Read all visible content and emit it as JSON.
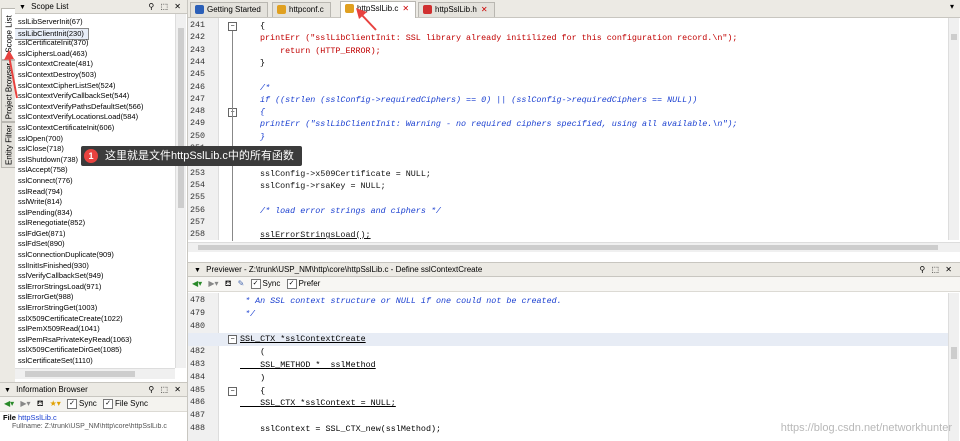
{
  "side_tabs": [
    "Scope List",
    "Project Browser",
    "Entity Filter"
  ],
  "scope_panel": {
    "title": "Scope List",
    "controls": "⌙ □ ×",
    "items": [
      "sslLibServerInit(67)",
      "sslLibClientInit(230)",
      "sslCertificateInit(370)",
      "sslCiphersLoad(463)",
      "sslContextCreate(481)",
      "sslContextDestroy(503)",
      "sslContextCipherListSet(524)",
      "sslContextVerifyCallbackSet(544)",
      "sslContextVerifyPathsDefaultSet(566)",
      "sslContextVerifyLocationsLoad(584)",
      "sslContextCertificateInit(606)",
      "sslOpen(700)",
      "sslClose(718)",
      "sslShutdown(738)",
      "sslAccept(758)",
      "sslConnect(776)",
      "sslRead(794)",
      "sslWrite(814)",
      "sslPending(834)",
      "sslRenegotiate(852)",
      "sslFdGet(871)",
      "sslFdSet(890)",
      "sslConnectionDuplicate(909)",
      "sslInitIsFinished(930)",
      "sslVerifyCallbackSet(949)",
      "sslErrorStringsLoad(971)",
      "sslErrorGet(988)",
      "sslErrorStringGet(1003)",
      "sslX509CertificateCreate(1022)",
      "sslPemX509Read(1041)",
      "sslPemRsaPrivateKeyRead(1063)",
      "sslX509CertificateDirGet(1085)",
      "sslCertificateSet(1110)"
    ],
    "selected_index": 1
  },
  "info_browser": {
    "title": "Information Browser",
    "sync_label": "Sync",
    "file_sync_label": "File Sync",
    "file_label": "File",
    "file_value": "httpSslLib.c",
    "fullname_partial": "Fullname: Z:\\trunk\\USP_NM\\http\\core\\httpSslLib.c"
  },
  "editor_tabs": [
    {
      "label": "Getting Started",
      "icon_color": "#2b5fb8"
    },
    {
      "label": "httpconf.c",
      "icon_color": "#e0a020"
    },
    {
      "label": "httpSslLib.c",
      "icon_color": "#e0a020",
      "active": true
    },
    {
      "label": "httpSslLib.h",
      "icon_color": "#d03030"
    }
  ],
  "code_lines": [
    {
      "n": "241",
      "t": "{"
    },
    {
      "n": "242",
      "t": "printErr (\"sslLibClientInit: SSL library already initilized for this configuration record.\\n\");"
    },
    {
      "n": "243",
      "t": "    return (HTTP_ERROR);"
    },
    {
      "n": "244",
      "t": "}"
    },
    {
      "n": "245",
      "t": ""
    },
    {
      "n": "246",
      "t": "/*"
    },
    {
      "n": "247",
      "t": "if ((strlen (sslConfig->requiredCiphers) == 0) || (sslConfig->requiredCiphers == NULL))"
    },
    {
      "n": "248",
      "t": "{"
    },
    {
      "n": "249",
      "t": "printErr (\"sslLibClientInit: Warning - no required ciphers specified, using all available.\\n\");"
    },
    {
      "n": "250",
      "t": "}"
    },
    {
      "n": "251",
      "t": ""
    },
    {
      "n": "252",
      "t": ""
    },
    {
      "n": "253",
      "t": "sslConfig->x509Certificate = NULL;"
    },
    {
      "n": "254",
      "t": "sslConfig->rsaKey = NULL;"
    },
    {
      "n": "255",
      "t": ""
    },
    {
      "n": "256",
      "t": "/* load error strings and ciphers */"
    },
    {
      "n": "257",
      "t": ""
    },
    {
      "n": "258",
      "t": "sslErrorStringsLoad();"
    }
  ],
  "previewer": {
    "title": "Previewer - Z:\\trunk\\USP_NM\\http\\core\\httpSslLib.c - Define sslContextCreate",
    "sync_label": "Sync",
    "prefer_label": "Prefer",
    "lines": [
      {
        "n": "478",
        "t": " * An SSL context structure or NULL if one could not be created."
      },
      {
        "n": "479",
        "t": " */"
      },
      {
        "n": "480",
        "t": ""
      },
      {
        "n": "481",
        "t": "SSL_CTX *sslContextCreate"
      },
      {
        "n": "482",
        "t": "    ("
      },
      {
        "n": "483",
        "t": "    SSL_METHOD *  sslMethod"
      },
      {
        "n": "484",
        "t": "    )"
      },
      {
        "n": "485",
        "t": "    {"
      },
      {
        "n": "486",
        "t": "    SSL_CTX *sslContext = NULL;"
      },
      {
        "n": "487",
        "t": ""
      },
      {
        "n": "488",
        "t": "    sslContext = SSL_CTX_new(sslMethod);"
      }
    ]
  },
  "callout": {
    "number": "1",
    "text": "这里就是文件httpSslLib.c中的所有函数"
  },
  "watermark": "https://blog.csdn.net/networkhunter",
  "colors": {
    "accent_red": "#e8423f",
    "selection": "#e8eef8",
    "comment": "#1a3fd0",
    "keyword": "#c00000"
  }
}
